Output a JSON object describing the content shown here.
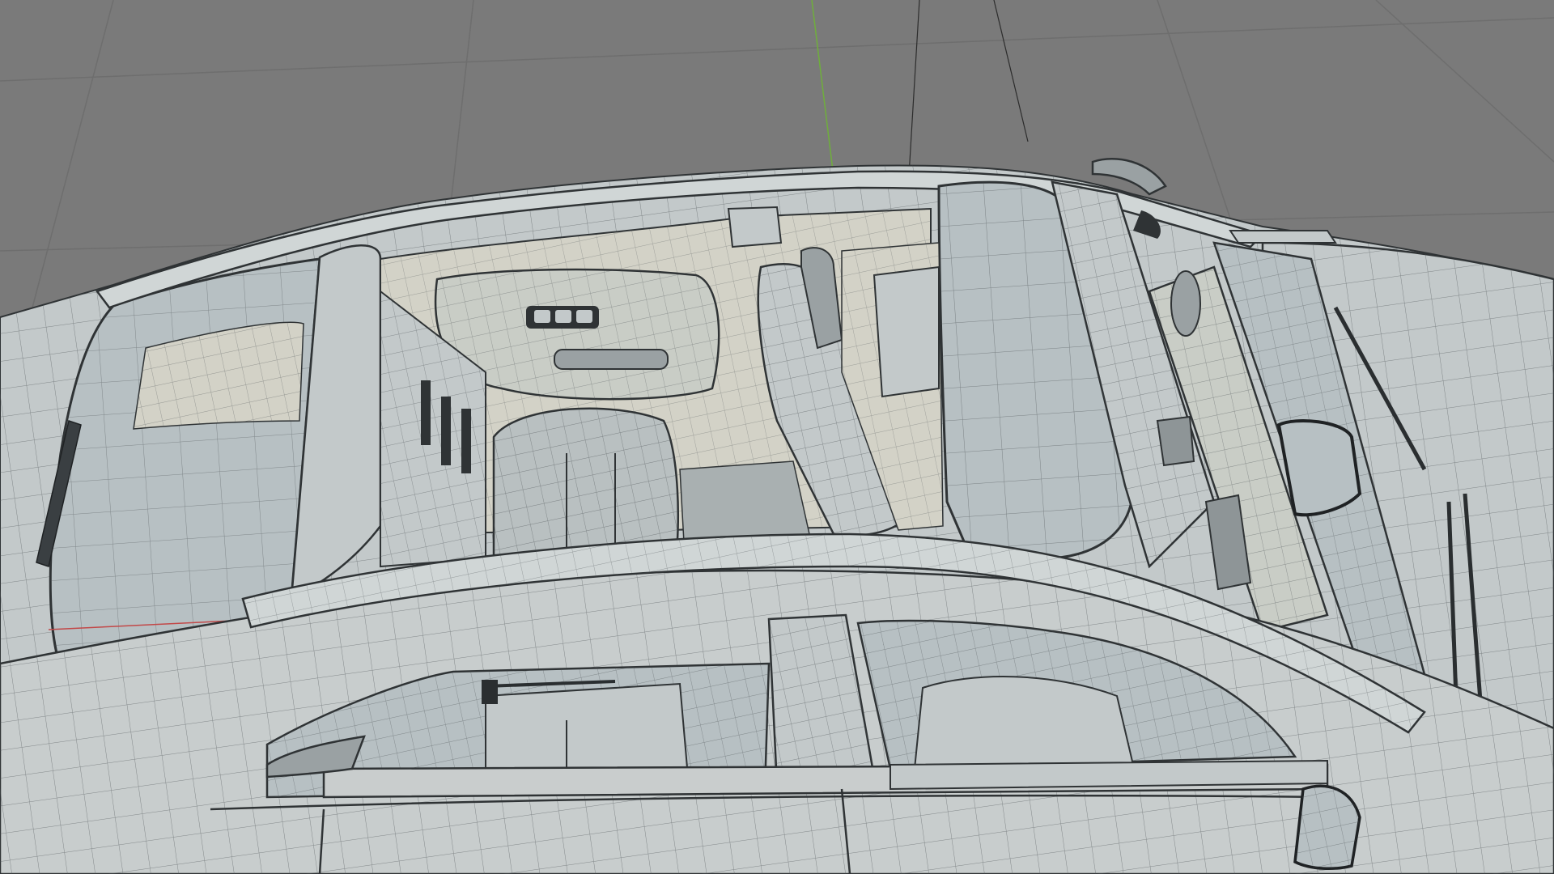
{
  "viewport": {
    "background": "#7a7a7a",
    "grid_color": "#6e6e6e",
    "axis_y_color": "#6fae3c",
    "axis_x_color": "#c24848"
  },
  "model": {
    "body_fill": "#c3c9ca",
    "body_fill_light": "#d0d6d6",
    "glass_fill": "#b7c0c3",
    "interior_fill": "#d3d2c7",
    "interior_dark": "#a9b0b1",
    "edge_color": "#2f3335",
    "wire_color": "#4a5053"
  }
}
